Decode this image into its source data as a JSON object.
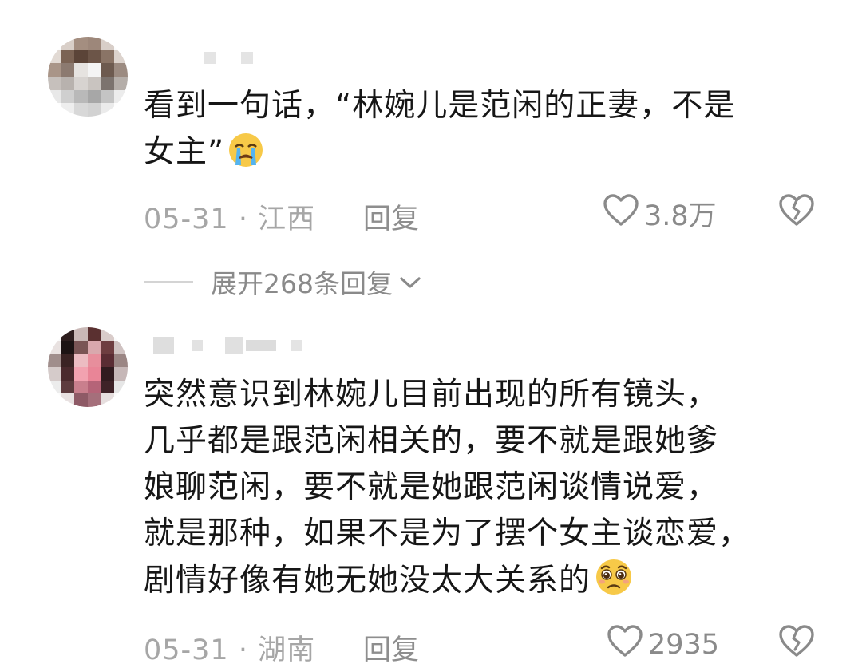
{
  "comments": [
    {
      "lines": [
        "看到一句话，“林婉儿是范闲的正妻，不是",
        "女主”"
      ],
      "emoji": "loudly-crying-face",
      "date": "05-31",
      "location": "江西",
      "separator": "·",
      "reply_label": "回复",
      "likes": "3.8万"
    },
    {
      "lines": [
        "突然意识到林婉儿目前出现的所有镜头，",
        "几乎都是跟范闲相关的，要不就是跟她爹",
        "娘聊范闲，要不就是她跟范闲谈情说爱，",
        "就是那种，如果不是为了摆个女主谈恋爱，",
        "剧情好像有她无她没太大关系的"
      ],
      "emoji": "pleading-face",
      "date": "05-31",
      "location": "湖南",
      "separator": "·",
      "reply_label": "回复",
      "likes": "2935"
    }
  ],
  "expand_replies": {
    "label": "展开268条回复"
  },
  "icons": {
    "like": "heart-outline-icon",
    "dislike": "broken-heart-icon",
    "expand": "chevron-down-icon"
  },
  "colors": {
    "text": "#161616",
    "meta": "#a6a6a6",
    "icon": "#8a8a8a",
    "emoji_yellow": "#f7c948"
  }
}
